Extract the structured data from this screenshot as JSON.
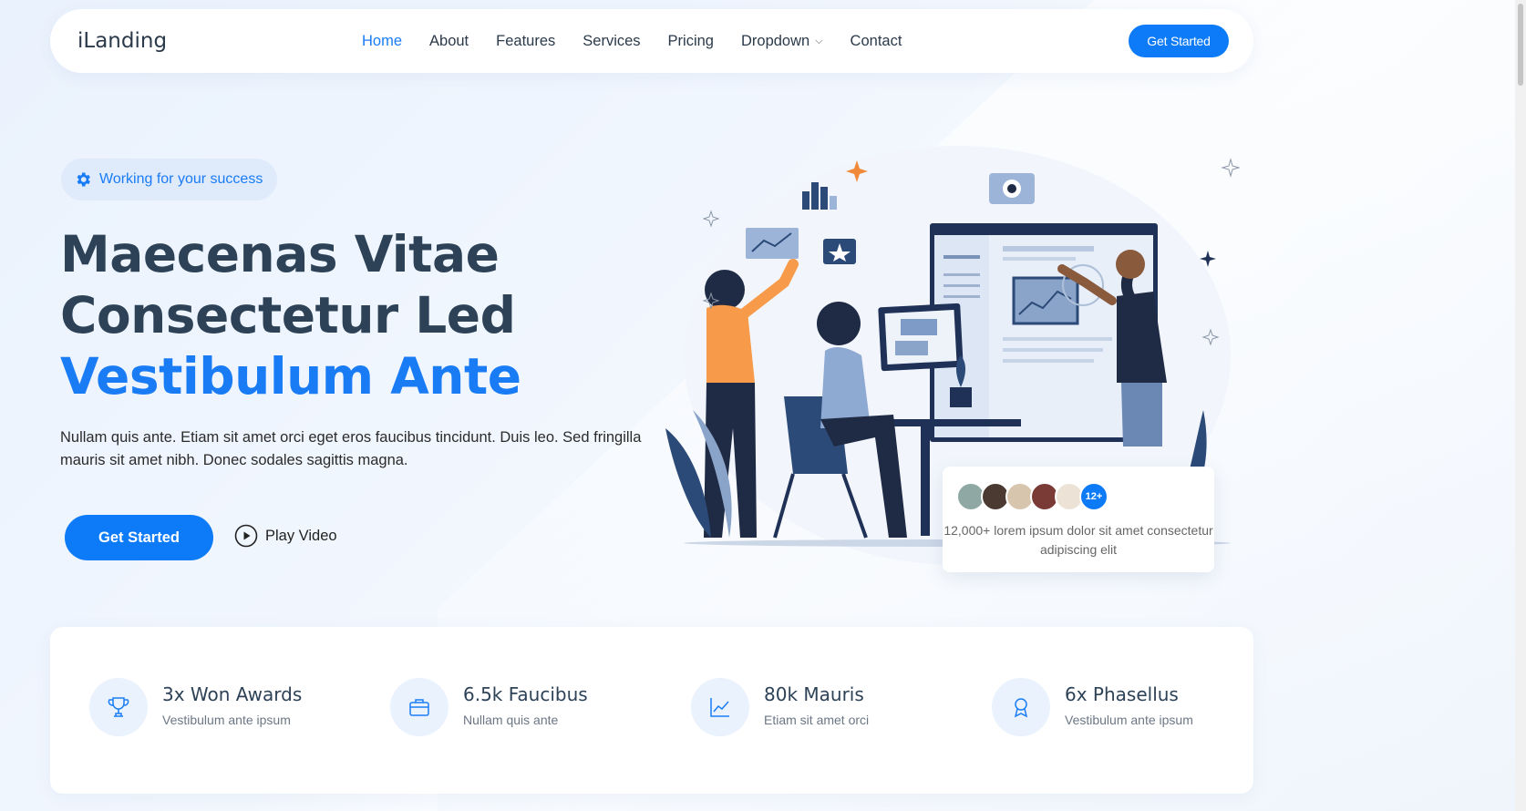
{
  "header": {
    "logo": "iLanding",
    "nav": [
      {
        "label": "Home",
        "active": true
      },
      {
        "label": "About"
      },
      {
        "label": "Features"
      },
      {
        "label": "Services"
      },
      {
        "label": "Pricing"
      },
      {
        "label": "Dropdown",
        "has_dropdown": true
      },
      {
        "label": "Contact"
      }
    ],
    "cta_label": "Get Started"
  },
  "hero": {
    "badge": {
      "icon": "gear-icon",
      "text": "Working for your success"
    },
    "title_line1": "Maecenas Vitae",
    "title_line2": "Consectetur Led",
    "title_line3": "Vestibulum Ante",
    "description": "Nullam quis ante. Etiam sit amet orci eget eros faucibus tincidunt. Duis leo. Sed fringilla mauris sit amet nibh. Donec sodales sagittis magna.",
    "primary_button": "Get Started",
    "video_link": "Play Video"
  },
  "social_proof": {
    "more_badge": "12+",
    "text": "12,000+ lorem ipsum dolor sit amet consectetur adipiscing elit"
  },
  "stats": [
    {
      "icon": "trophy-icon",
      "title": "3x Won Awards",
      "subtitle": "Vestibulum ante ipsum"
    },
    {
      "icon": "briefcase-icon",
      "title": "6.5k Faucibus",
      "subtitle": "Nullam quis ante"
    },
    {
      "icon": "graph-up-icon",
      "title": "80k Mauris",
      "subtitle": "Etiam sit amet orci"
    },
    {
      "icon": "award-icon",
      "title": "6x Phasellus",
      "subtitle": "Vestibulum ante ipsum"
    }
  ],
  "colors": {
    "accent": "#0d7bf7",
    "heading": "#2d4257",
    "background": "#eef4fc"
  }
}
